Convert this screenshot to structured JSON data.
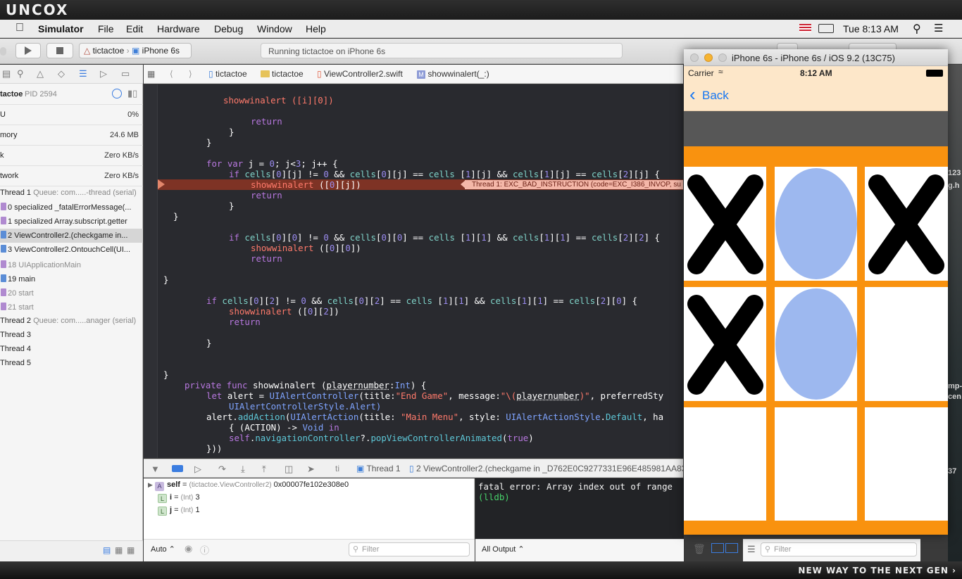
{
  "banner": {
    "logo": "UNCOX",
    "tagline": "NEW WAY TO THE NEXT GEN ›"
  },
  "menubar": {
    "app_name": "Simulator",
    "items": [
      "File",
      "Edit",
      "Hardware",
      "Debug",
      "Window",
      "Help"
    ],
    "clock": "Tue 8:13 AM"
  },
  "toolbar": {
    "scheme_project": "tictactoe",
    "scheme_device": "iPhone 6s",
    "activity": "Running tictactoe on iPhone 6s"
  },
  "navigator": {
    "process": "tactoe",
    "pid": "PID 2594",
    "gauges": [
      {
        "label": "U",
        "value": "0%"
      },
      {
        "label": "mory",
        "value": "24.6 MB"
      },
      {
        "label": "k",
        "value": "Zero KB/s"
      },
      {
        "label": "twork",
        "value": "Zero KB/s"
      }
    ],
    "thread1": {
      "name": "Thread 1",
      "queue": "Queue: com.....-thread (serial)"
    },
    "frames": [
      {
        "label": "0 specialized _fatalErrorMessage(...",
        "state": "normal",
        "icon": "purple"
      },
      {
        "label": "1 specialized Array.subscript.getter",
        "state": "normal",
        "icon": "purple"
      },
      {
        "label": "2 ViewController2.(checkgame in...",
        "state": "selected",
        "icon": "blue"
      },
      {
        "label": "3 ViewController2.OntouchCell(UI...",
        "state": "normal",
        "icon": "blue"
      },
      {
        "label": "18 UIApplicationMain",
        "state": "dim",
        "icon": "purple"
      },
      {
        "label": "19 main",
        "state": "normal",
        "icon": "blue"
      },
      {
        "label": "20 start",
        "state": "dim",
        "icon": "purple"
      },
      {
        "label": "21 start",
        "state": "dim",
        "icon": "purple"
      }
    ],
    "thread2": {
      "name": "Thread 2",
      "queue": "Queue: com.....anager (serial)"
    },
    "other_threads": [
      "Thread 3",
      "Thread 4",
      "Thread 5"
    ]
  },
  "jumpbar": {
    "crumbs": [
      "tictactoe",
      "tictactoe",
      "ViewController2.swift",
      "showwinalert(_:)"
    ]
  },
  "editor": {
    "error_message": "Thread 1: EXC_BAD_INSTRUCTION (code=EXC_I386_INVOP, su",
    "lines": [
      "showwinalert ([i][0])",
      "return",
      "}",
      "}",
      "for var j = 0; j<3; j++ {",
      "if cells[0][j] != 0 && cells[0][j] == cells [1][j] && cells[1][j] == cells[2][j] {",
      "showwinalert ([0][j])",
      "return",
      "}",
      "}",
      "if cells[0][0] != 0 && cells[0][0] == cells [1][1] && cells[1][1] == cells[2][2] {",
      "showwinalert ([0][0])",
      "return",
      "}",
      "if cells[0][2] != 0 && cells[0][2] == cells [1][1] && cells[1][1] == cells[2][0] {",
      "showwinalert ([0][2])",
      "return",
      "}",
      "}",
      "private func showwinalert (playernumber:Int) {",
      "let alert = UIAlertController(title:\"End Game\", message:\"\\(playernumber)\", preferredSty",
      "UIAlertControllerStyle.Alert)",
      "alert.addAction(UIAlertAction(title: \"Main Menu\", style: UIAlertActionStyle.Default, ha",
      "{ (ACTION) -> Void in",
      "self.navigationController?.popViewControllerAnimated(true)",
      "}))"
    ]
  },
  "debugbar": {
    "thread_crumb": "Thread 1",
    "frame_crumb": "2 ViewController2.(checkgame in _D762E0C9277331E96E485981AA83",
    "crumb_prefix": "ti"
  },
  "variables": [
    {
      "badge": "A",
      "name": "self",
      "type": "(tictactoe.ViewController2)",
      "value": "0x00007fe102e308e0"
    },
    {
      "badge": "L",
      "name": "i",
      "type": "(Int)",
      "value": "3"
    },
    {
      "badge": "L",
      "name": "j",
      "type": "(Int)",
      "value": "1"
    }
  ],
  "variables_footer": {
    "mode": "Auto ⌃",
    "filter_placeholder": "Filter"
  },
  "console": {
    "error": "fatal error: Array index out of range",
    "prompt": "(lldb)"
  },
  "console_footer": {
    "output": "All Output ⌃"
  },
  "right_footer": {
    "filter_placeholder": "Filter"
  },
  "simulator": {
    "title": "iPhone 6s - iPhone 6s / iOS 9.2 (13C75)",
    "carrier": "Carrier",
    "time": "8:12 AM",
    "back_label": "Back",
    "board": [
      [
        "X",
        "O",
        "X"
      ],
      [
        "X",
        "O",
        ""
      ],
      [
        "",
        "",
        ""
      ]
    ],
    "colors": {
      "board": "#f9920f",
      "o_piece": "#9db8ef",
      "x_piece": "#000000",
      "nav": "#fde7c9",
      "back": "#1877f2"
    }
  },
  "desktop_fragments": [
    "123",
    "g.h",
    "mp-",
    "cen",
    "37"
  ]
}
